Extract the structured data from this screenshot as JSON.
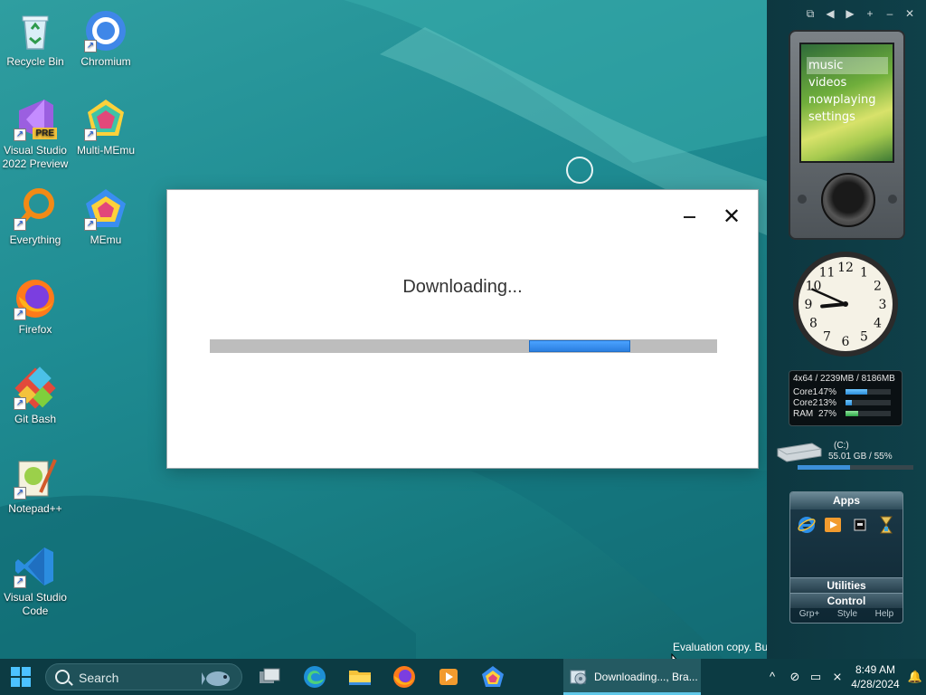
{
  "desktop": {
    "icons": [
      {
        "label": "Recycle Bin"
      },
      {
        "label": "Chromium"
      },
      {
        "label": "Visual Studio 2022 Preview",
        "badge": "PRE"
      },
      {
        "label": "Multi-MEmu"
      },
      {
        "label": "Everything"
      },
      {
        "label": "MEmu"
      },
      {
        "label": "Firefox"
      },
      {
        "label": "Git Bash"
      },
      {
        "label": "Notepad++"
      },
      {
        "label": "Visual Studio Code"
      }
    ],
    "evaluation_text": "Evaluation copy. Bu"
  },
  "download_window": {
    "title": "Downloading...",
    "progress_fraction_start": 0.63,
    "progress_fraction_width": 0.2,
    "minimize_icon": "minimize-icon",
    "close_icon": "close-icon",
    "close_glyph": "✕"
  },
  "sidebar": {
    "toolbar": [
      "⧉",
      "◀",
      "▶",
      "+",
      "–",
      "✕"
    ],
    "zune_menu": [
      "music",
      "videos",
      "nowplaying",
      "settings"
    ],
    "clock": {
      "hour": 8,
      "minute": 49
    },
    "meter": {
      "header": "4x64 / 2239MB / 8186MB",
      "rows": [
        {
          "label": "Core1",
          "pct_text": "47%",
          "value": 47
        },
        {
          "label": "Core2",
          "pct_text": "13%",
          "value": 13
        },
        {
          "label": "RAM",
          "pct_text": "27%",
          "value": 27
        }
      ]
    },
    "drive": {
      "name": "(C:)",
      "info": "55.01 GB / 55%",
      "used_pct": 45
    },
    "apps": {
      "header": "Apps",
      "icons": [
        "internet-explorer-icon",
        "media-player-icon",
        "terminal-icon",
        "hourglass-icon"
      ],
      "utilities": "Utilities",
      "control": "Control",
      "footer": [
        "Grp+",
        "Style",
        "Help"
      ]
    }
  },
  "taskbar": {
    "search_placeholder": "Search",
    "pinned": [
      "task-view-icon",
      "edge-icon",
      "file-explorer-icon",
      "firefox-icon",
      "media-player-icon",
      "memu-icon"
    ],
    "active_task": "Downloading..., Bra...",
    "time": "8:49 AM",
    "date": "4/28/2024"
  },
  "colors": {
    "accent": "#2b7fe0",
    "taskbar": "#0c3b43"
  }
}
